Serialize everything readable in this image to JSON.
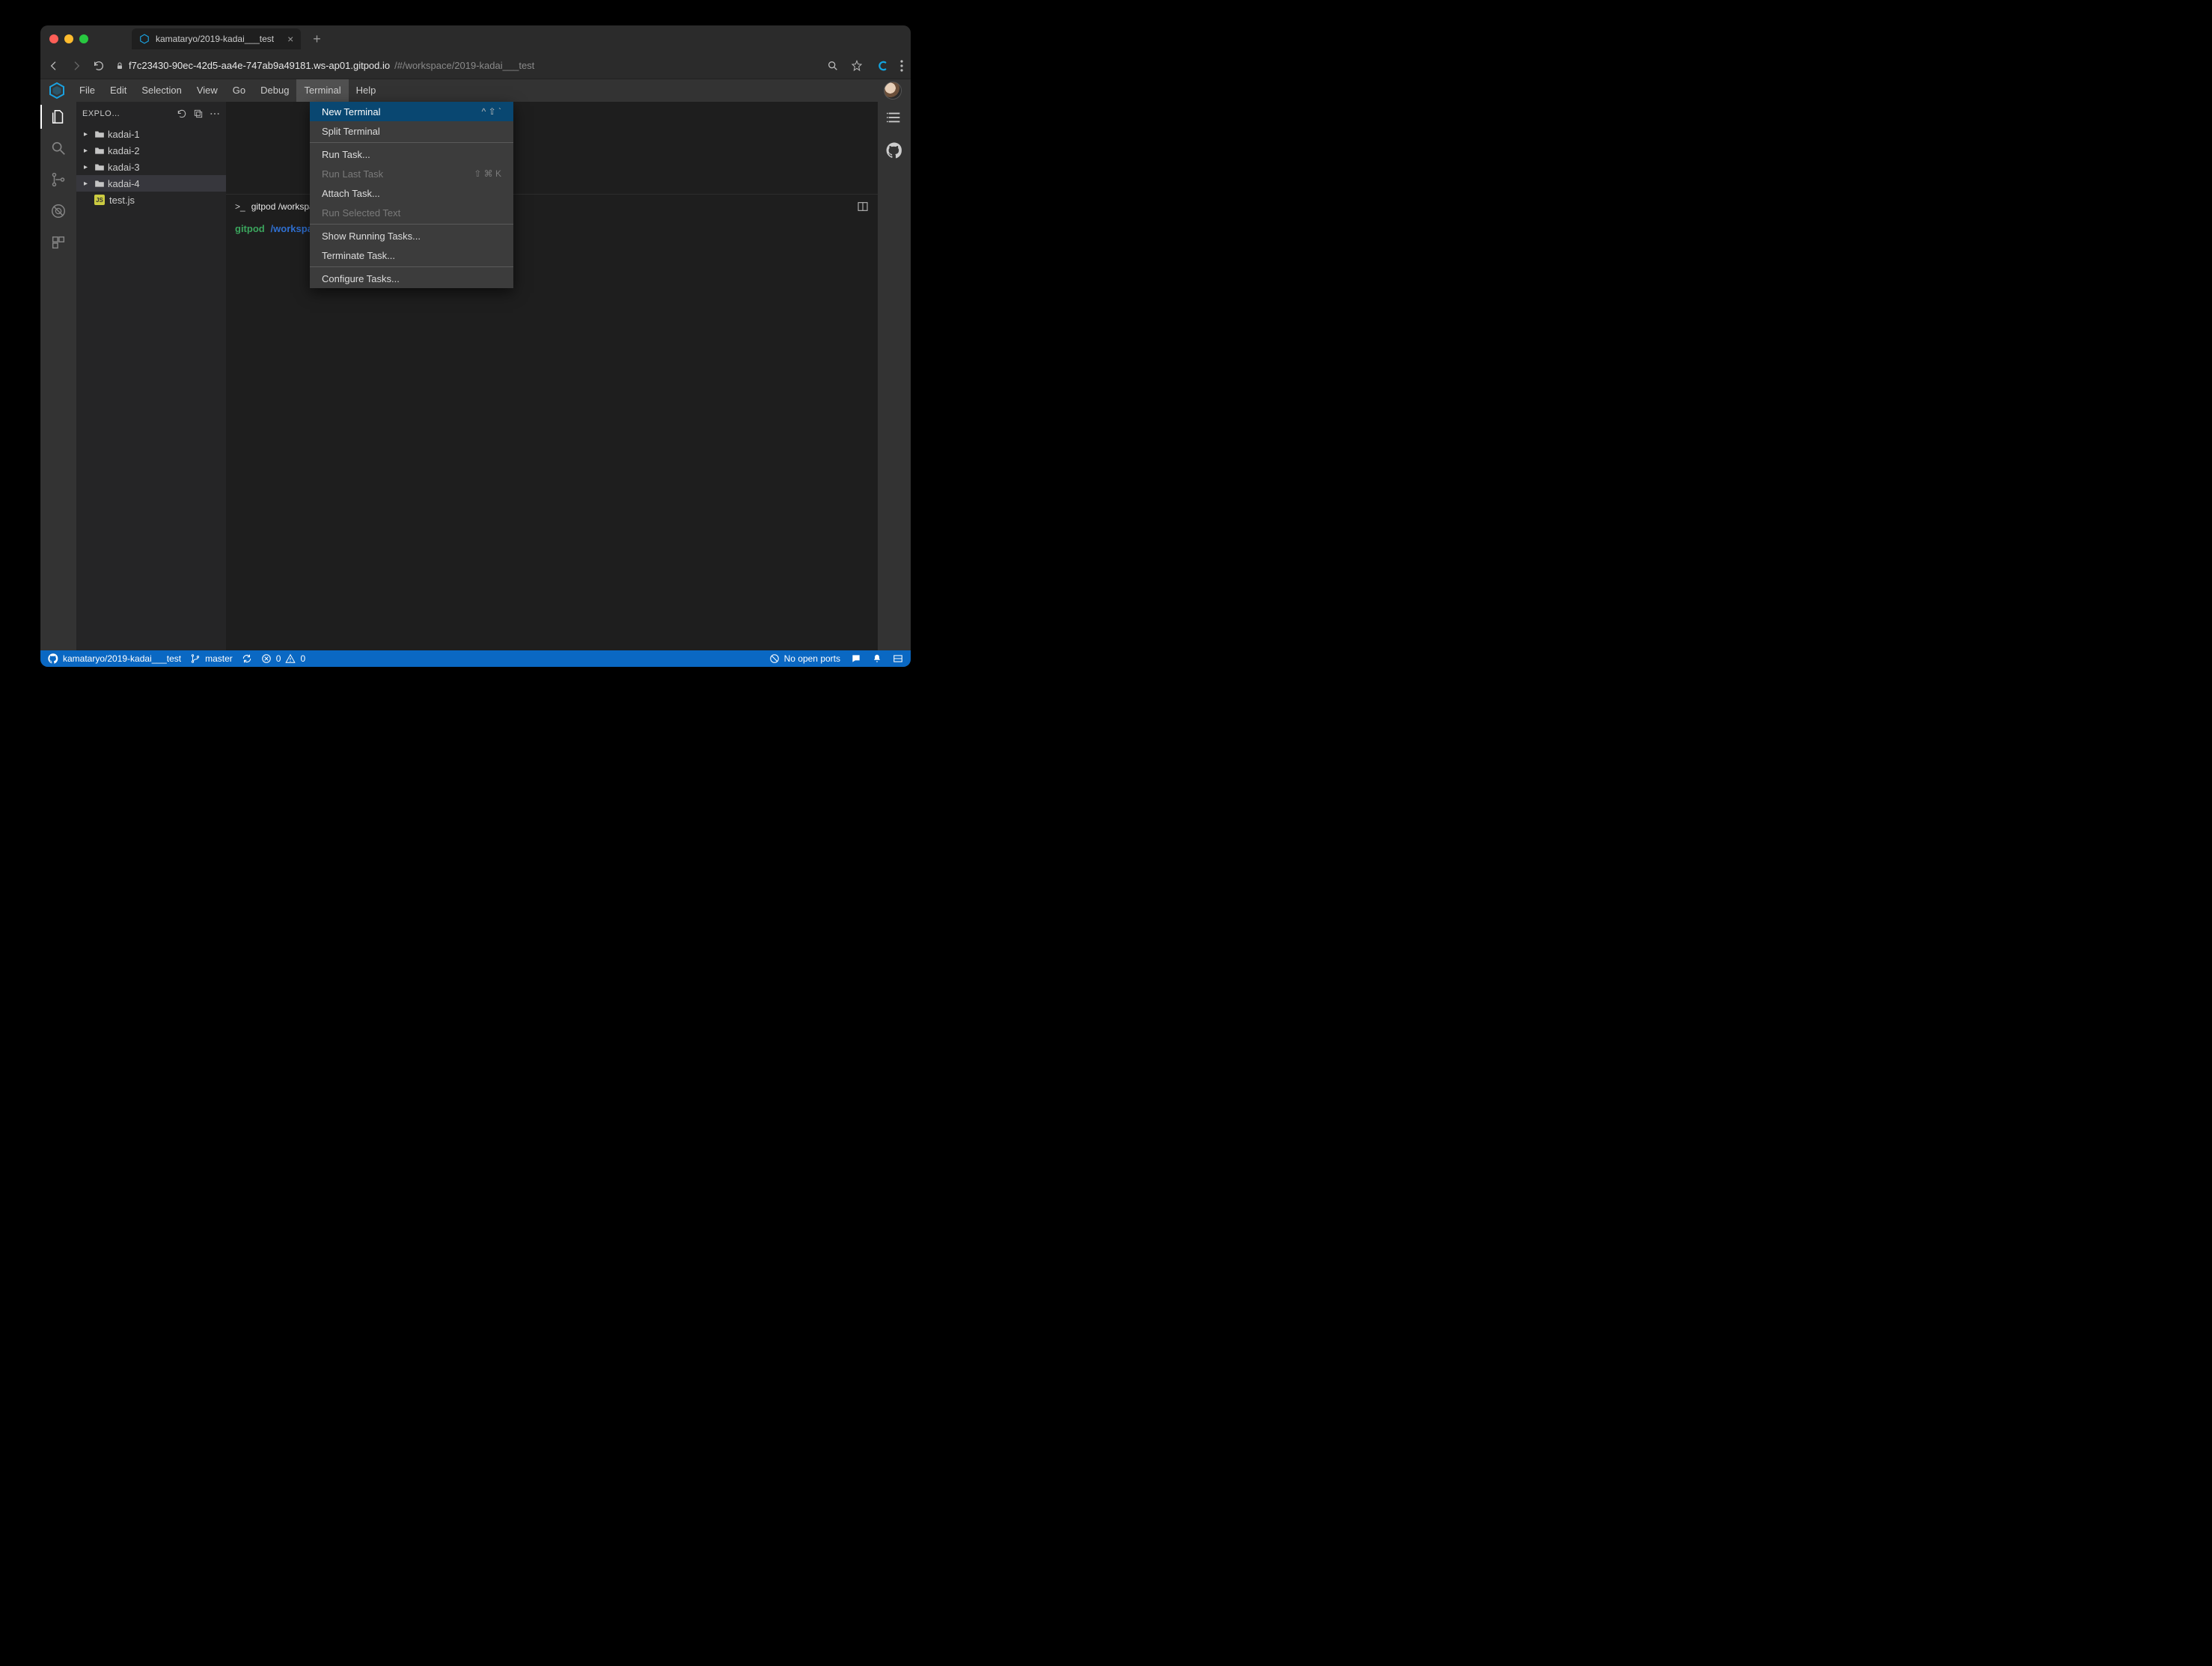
{
  "browser": {
    "tab_title": "kamataryo/2019-kadai___test",
    "url_host": "f7c23430-90ec-42d5-aa4e-747ab9a49181.ws-ap01.gitpod.io",
    "url_path": "/#/workspace/2019-kadai___test"
  },
  "menubar": {
    "items": [
      "File",
      "Edit",
      "Selection",
      "View",
      "Go",
      "Debug",
      "Terminal",
      "Help"
    ],
    "active": "Terminal"
  },
  "dropdown": {
    "groups": [
      [
        {
          "label": "New Terminal",
          "shortcut": "^ ⇧ `",
          "hover": true,
          "disabled": false
        },
        {
          "label": "Split Terminal",
          "shortcut": "",
          "hover": false,
          "disabled": false
        }
      ],
      [
        {
          "label": "Run Task...",
          "shortcut": "",
          "hover": false,
          "disabled": false
        },
        {
          "label": "Run Last Task",
          "shortcut": "⇧ ⌘ K",
          "hover": false,
          "disabled": true
        },
        {
          "label": "Attach Task...",
          "shortcut": "",
          "hover": false,
          "disabled": false
        },
        {
          "label": "Run Selected Text",
          "shortcut": "",
          "hover": false,
          "disabled": true
        }
      ],
      [
        {
          "label": "Show Running Tasks...",
          "shortcut": "",
          "hover": false,
          "disabled": false
        },
        {
          "label": "Terminate Task...",
          "shortcut": "",
          "hover": false,
          "disabled": false
        }
      ],
      [
        {
          "label": "Configure Tasks...",
          "shortcut": "",
          "hover": false,
          "disabled": false
        }
      ]
    ]
  },
  "sidebar": {
    "title": "EXPLO…",
    "folders": [
      "kadai-1",
      "kadai-2",
      "kadai-3",
      "kadai-4"
    ],
    "selected_index": 3,
    "file": "test.js"
  },
  "terminal": {
    "tab_prefix": ">_",
    "tab_label": "gitpod /workspace/…",
    "prompt_user": "gitpod",
    "prompt_path": "/workspace/",
    "prompt_suffix": "$"
  },
  "statusbar": {
    "repo": "kamataryo/2019-kadai___test",
    "branch": "master",
    "errors": "0",
    "warnings": "0",
    "ports": "No open ports"
  }
}
